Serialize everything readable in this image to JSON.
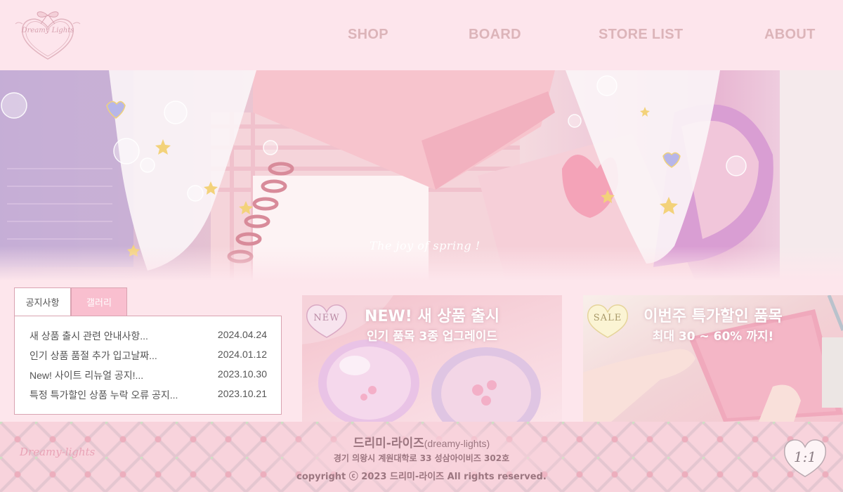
{
  "header": {
    "logo_text": "Dreamy Lights",
    "nav": [
      "SHOP",
      "BOARD",
      "STORE LIST",
      "ABOUT"
    ]
  },
  "hero": {
    "caption": "The joy of spring !"
  },
  "notice": {
    "tabs": [
      "공지사항",
      "갤러리"
    ],
    "items": [
      {
        "title": "새 상품 출시 관련 안내사항...",
        "date": "2024.04.24"
      },
      {
        "title": "인기 상품 품절 추가 입고날짜...",
        "date": "2024.01.12"
      },
      {
        "title": "New! 사이트 리뉴얼 공지!...",
        "date": "2023.10.30"
      },
      {
        "title": "특정 특가할인 상품 누락 오류 공지...",
        "date": "2023.10.21"
      }
    ]
  },
  "promos": {
    "new": {
      "badge": "NEW",
      "heading": "NEW! 새 상품 출시",
      "sub": "인기 품목 3종 업그레이드"
    },
    "sale": {
      "badge": "SALE",
      "heading": "이번주 특가할인 품목",
      "sub": "최대 30 ~ 60% 까지!"
    }
  },
  "footer": {
    "logo_text": "Dreamy-lights",
    "company_name": "드리미-라이즈",
    "company_en": "(dreamy-lights)",
    "address": "경기 의왕시 계원대학로 33 성삼아이비즈 302호",
    "copyright": "copyright ⓒ 2023 드리미-라이즈 All rights reserved.",
    "chat_label": "1:1"
  },
  "colors": {
    "header_bg": "#fde5ec",
    "nav_text": "#dcb4b9",
    "tab_active_bg": "#f9bfcf",
    "border": "#d9a3b1",
    "footer_text": "#9c7680"
  }
}
